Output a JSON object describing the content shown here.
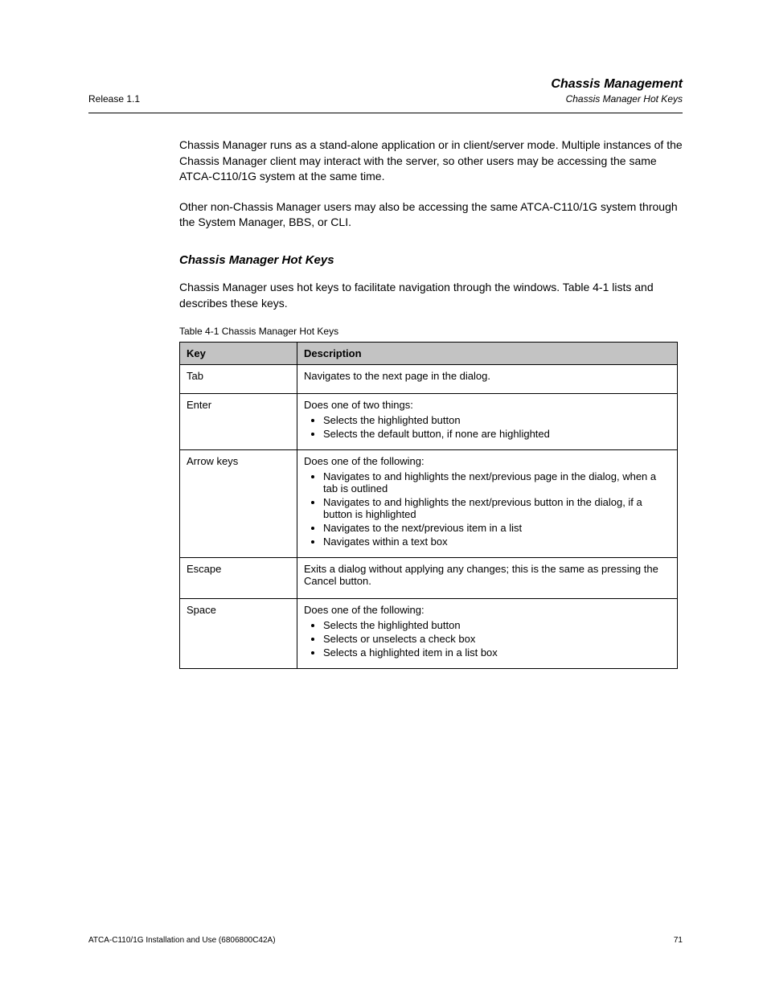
{
  "header": {
    "left": "Release 1.1",
    "right_line1": "Chassis Management",
    "right_line2": "Chassis Manager Hot Keys"
  },
  "paragraphs": {
    "p1": "Chassis Manager runs as a stand-alone application or in client/server mode. Multiple instances of the Chassis Manager client may interact with the server, so other users may be accessing the same ATCA-C110/1G system at the same time.",
    "p2": "Other non-Chassis Manager users may also be accessing the same ATCA-C110/1G system through the System Manager, BBS, or CLI."
  },
  "subsection": {
    "heading": "Chassis Manager Hot Keys",
    "intro": "Chassis Manager uses hot keys to facilitate navigation through the windows. Table 4-1 lists and describes these keys.",
    "table_caption": "Table 4-1   Chassis Manager Hot Keys"
  },
  "table": {
    "headers": [
      "Key",
      "Description"
    ],
    "rows": [
      {
        "key": "Tab",
        "title": "Navigates to the next page in the dialog.",
        "bullets": []
      },
      {
        "key": "Enter",
        "title": "Does one of two things:",
        "bullets": [
          "Selects the highlighted button",
          "Selects the default button, if none are highlighted"
        ]
      },
      {
        "key": "Arrow keys",
        "title": "Does one of the following:",
        "bullets": [
          "Navigates to and highlights the next/previous page in the dialog, when a tab is outlined",
          "Navigates to and highlights the next/previous button in the dialog, if a button is highlighted",
          "Navigates to the next/previous item in a list",
          "Navigates within a text box"
        ]
      },
      {
        "key": "Escape",
        "title": "Exits a dialog without applying any changes; this is the same as pressing the Cancel button.",
        "bullets": []
      },
      {
        "key": "Space",
        "title": "Does one of the following:",
        "bullets": [
          "Selects the highlighted button",
          "Selects or unselects a check box",
          "Selects a highlighted item in a list box"
        ]
      }
    ]
  },
  "footer": {
    "left": "ATCA-C110/1G Installation and Use (6806800C42A)",
    "right": "71"
  }
}
